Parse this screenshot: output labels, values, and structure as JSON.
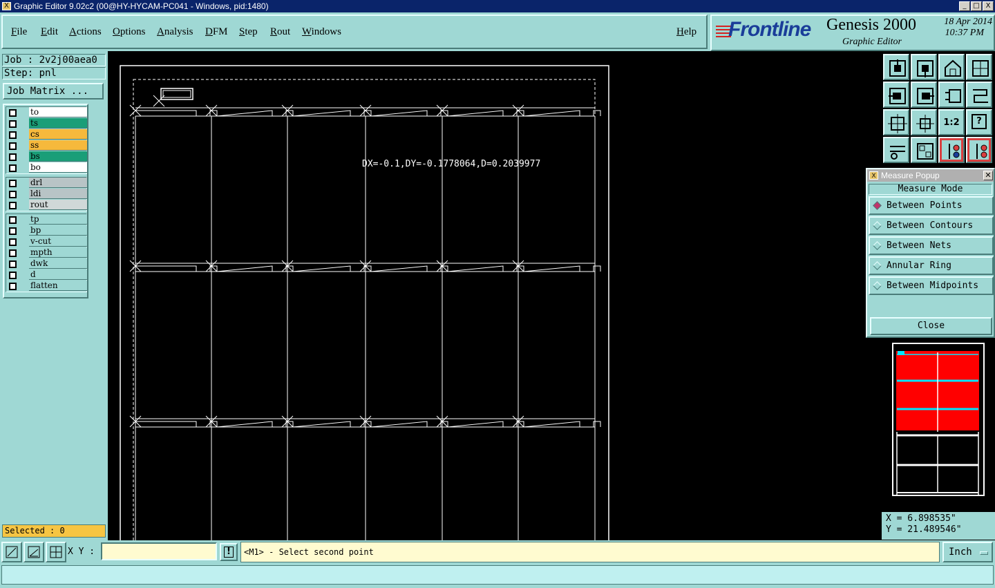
{
  "window": {
    "title": "Graphic Editor 9.02c2 (00@HY-HYCAM-PC041 - Windows, pid:1480)",
    "controls": [
      "_",
      "□",
      "X"
    ]
  },
  "menu": {
    "items": [
      "File",
      "Edit",
      "Actions",
      "Options",
      "Analysis",
      "DFM",
      "Step",
      "Rout",
      "Windows"
    ],
    "help": "Help"
  },
  "brand": {
    "logo": "Frontline",
    "product": "Genesis 2000",
    "subtitle": "Graphic Editor",
    "date": "18 Apr 2014",
    "time": "10:37 PM"
  },
  "job": {
    "job_label": "Job : 2v2j00aea0",
    "step_label": "Step: pnl",
    "matrix_button": "Job Matrix ..."
  },
  "layers": {
    "group1": [
      {
        "name": "to",
        "color": "#ffffff"
      },
      {
        "name": "ts",
        "color": "#1a9e78"
      },
      {
        "name": "cs",
        "color": "#f6b93c"
      },
      {
        "name": "ss",
        "color": "#f6b93c"
      },
      {
        "name": "bs",
        "color": "#1a9e78"
      },
      {
        "name": "bo",
        "color": "#ffffff"
      }
    ],
    "group2": [
      {
        "name": "drl",
        "color": "#b8c4c6"
      },
      {
        "name": "ldi",
        "color": "#b8c4c6"
      },
      {
        "name": "rout",
        "color": "#d0d8d8"
      }
    ],
    "group3": [
      {
        "name": "tp",
        "color": "#9fd8d4"
      },
      {
        "name": "bp",
        "color": "#9fd8d4"
      },
      {
        "name": "v-cut",
        "color": "#9fd8d4"
      },
      {
        "name": "mpth",
        "color": "#9fd8d4"
      },
      {
        "name": "dwk",
        "color": "#9fd8d4"
      },
      {
        "name": "d",
        "color": "#9fd8d4"
      },
      {
        "name": "flatten",
        "color": "#9fd8d4"
      }
    ],
    "selected": "Selected : 0"
  },
  "canvas": {
    "measure_text": "DX=-0.1,DY=-0.1778064,D=0.2039977"
  },
  "toolbar": {
    "icons": [
      "zoom-top-icon",
      "zoom-bottom-icon",
      "home-icon",
      "grid-view-icon",
      "pan-left-icon",
      "pan-right-icon",
      "undo-view-icon",
      "snap-icon",
      "fit-screen-icon",
      "center-icon",
      "scale-icon",
      "help-icon",
      "tools-icon",
      "layout-icon",
      "netlist-top-icon",
      "netlist-bottom-icon"
    ],
    "scale_label": "1:2",
    "help_label": "?"
  },
  "measure_popup": {
    "title": "Measure Popup",
    "mode_label": "Measure Mode",
    "options": [
      "Between Points",
      "Between Contours",
      "Between Nets",
      "Annular Ring",
      "Between Midpoints"
    ],
    "selected_index": 0,
    "close": "Close"
  },
  "coords": {
    "x": "X = 6.898535\"",
    "y": "Y = 21.489546\""
  },
  "status": {
    "xy_label": "X Y :",
    "xy_value": "",
    "bang": "!",
    "prompt": "<M1> - Select second point",
    "units": "Inch"
  },
  "colors": {
    "panel": "#9fd8d4",
    "canvas": "#000000",
    "highlight": "#ff0000",
    "overview_accent": "#00e5ff"
  }
}
